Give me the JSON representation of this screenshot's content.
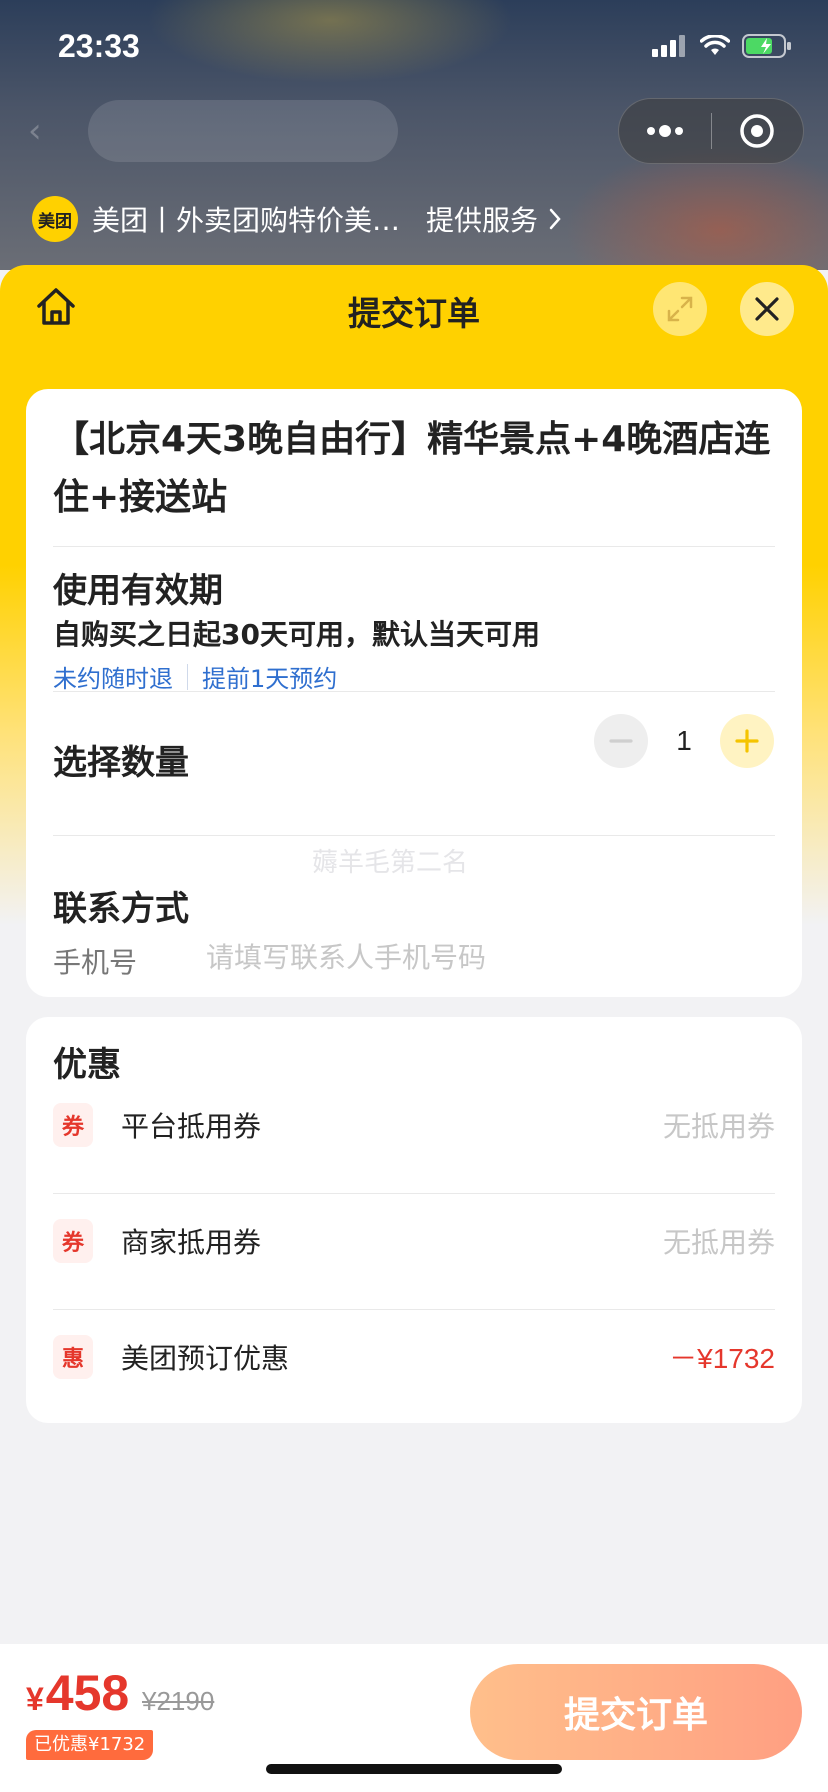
{
  "status_bar": {
    "time": "23:33"
  },
  "mini_program": {
    "logo_text": "美团",
    "name": "美团丨外卖团购特价美…",
    "service_label": "提供服务"
  },
  "sheet": {
    "title": "提交订单"
  },
  "product": {
    "title": "【北京4天3晚自由行】精华景点+4晚酒店连住+接送站"
  },
  "validity": {
    "heading": "使用有效期",
    "text": "自购买之日起30天可用，默认当天可用",
    "tags": [
      "未约随时退",
      "提前1天预约"
    ]
  },
  "quantity": {
    "heading": "选择数量",
    "value": "1"
  },
  "contact": {
    "heading": "联系方式",
    "phone_label": "手机号",
    "phone_placeholder": "请填写联系人手机号码"
  },
  "watermark": "薅羊毛第二名",
  "discounts": {
    "heading": "优惠",
    "items": [
      {
        "badge": "券",
        "name": "平台抵用券",
        "value": "无抵用券"
      },
      {
        "badge": "券",
        "name": "商家抵用券",
        "value": "无抵用券"
      },
      {
        "badge": "惠",
        "name": "美团预订优惠",
        "value": "－¥1732"
      }
    ]
  },
  "bottom": {
    "currency": "¥",
    "price": "458",
    "original_price": "¥2190",
    "saved": "已优惠¥1732",
    "submit_label": "提交订单"
  },
  "colors": {
    "brand_yellow": "#ffd100",
    "price_red": "#e5372c",
    "link_blue": "#2f6fcf",
    "submit_gradient_start": "#ffbf8b",
    "submit_gradient_end": "#ff9f82"
  }
}
